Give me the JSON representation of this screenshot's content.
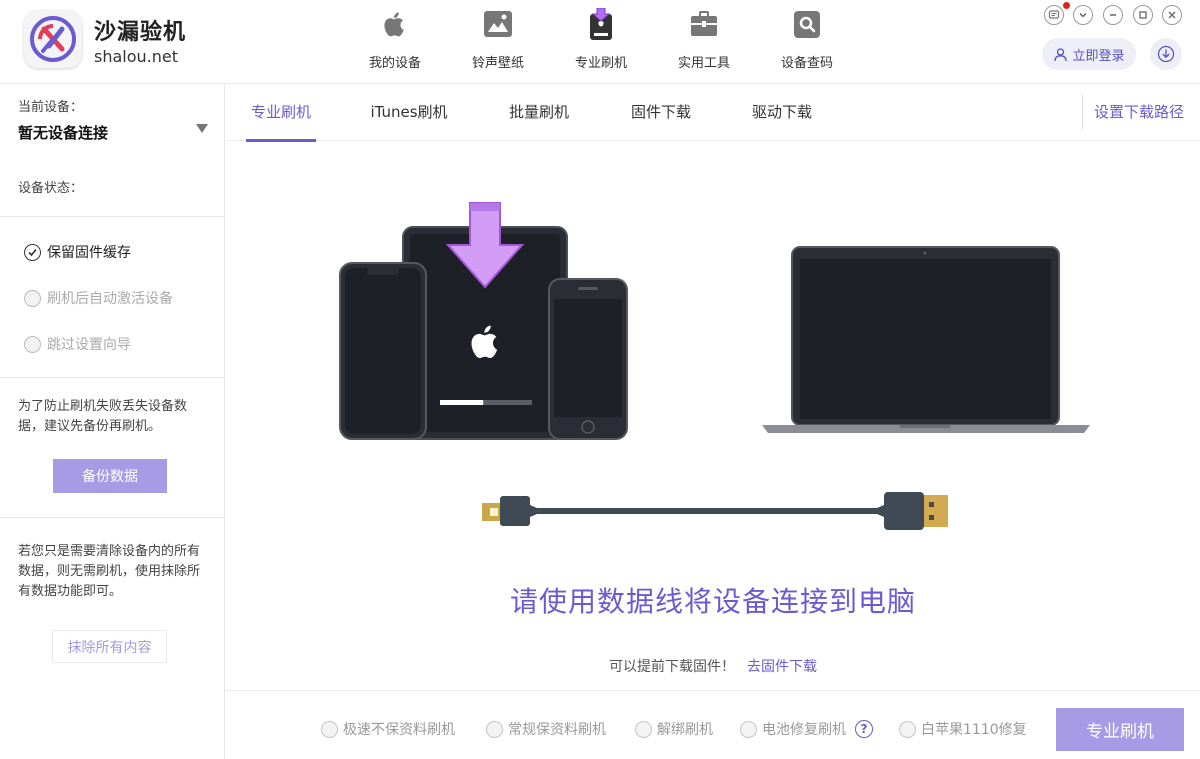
{
  "app": {
    "name": "沙漏验机",
    "domain": "shalou.net"
  },
  "nav": [
    {
      "label": "我的设备",
      "icon": "apple-icon"
    },
    {
      "label": "铃声壁纸",
      "icon": "image-icon"
    },
    {
      "label": "专业刷机",
      "icon": "flash-device-icon"
    },
    {
      "label": "实用工具",
      "icon": "toolbox-icon"
    },
    {
      "label": "设备查码",
      "icon": "search-icon"
    }
  ],
  "header_actions": {
    "login_label": "立即登录"
  },
  "sidebar": {
    "current_device_label": "当前设备：",
    "device_value": "暂无设备连接",
    "status_label": "设备状态：",
    "options": [
      {
        "label": "保留固件缓存",
        "checked": true
      },
      {
        "label": "刷机后自动激活设备",
        "checked": false
      },
      {
        "label": "跳过设置向导",
        "checked": false
      }
    ],
    "backup_note": "为了防止刷机失败丢失设备数据，建议先备份再刷机。",
    "backup_button": "备份数据",
    "erase_note": "若您只是需要清除设备内的所有数据，则无需刷机，使用抹除所有数据功能即可。",
    "erase_button": "抹除所有内容"
  },
  "tabs": [
    {
      "label": "专业刷机",
      "active": true
    },
    {
      "label": "iTunes刷机",
      "active": false
    },
    {
      "label": "批量刷机",
      "active": false
    },
    {
      "label": "固件下载",
      "active": false
    },
    {
      "label": "驱动下载",
      "active": false
    }
  ],
  "set_download_path": "设置下载路径",
  "main": {
    "connect_prompt": "请使用数据线将设备连接到电脑",
    "download_hint": "可以提前下载固件！",
    "download_link": "去固件下载",
    "progress_fraction": 0.47
  },
  "modes": [
    {
      "label": "极速不保资料刷机"
    },
    {
      "label": "常规保资料刷机"
    },
    {
      "label": "解绑刷机"
    },
    {
      "label": "电池修复刷机",
      "help": "?"
    },
    {
      "label": "白苹果1110修复"
    }
  ],
  "flash_button": "专业刷机",
  "colors": {
    "accent": "#6a5cd0",
    "button": "#a79be6",
    "arrow": "#c98bf0"
  }
}
